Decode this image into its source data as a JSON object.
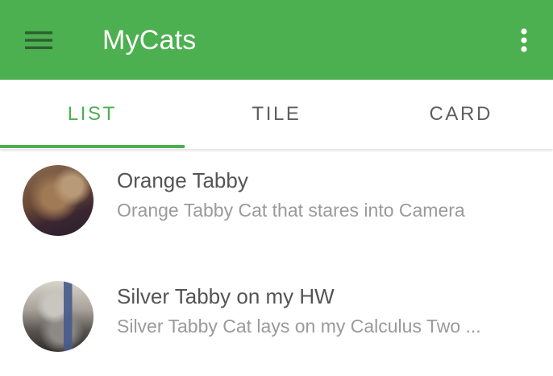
{
  "colors": {
    "primary": "#4caf50",
    "toolbar_text": "#ffffff",
    "tab_inactive": "#5f5f5f",
    "title_text": "#545454",
    "subtitle_text": "#9a9a9a"
  },
  "toolbar": {
    "title": "MyCats",
    "menu_icon": "hamburger-menu-icon",
    "overflow_icon": "more-vertical-icon"
  },
  "tabs": [
    {
      "label": "LIST",
      "active": true
    },
    {
      "label": "TILE",
      "active": false
    },
    {
      "label": "CARD",
      "active": false
    }
  ],
  "items": [
    {
      "title": "Orange Tabby",
      "subtitle": "Orange Tabby Cat that stares into Camera",
      "avatar": "orange-tabby-cat-photo"
    },
    {
      "title": "Silver Tabby on my HW",
      "subtitle": "Silver Tabby Cat lays on my Calculus Two ...",
      "avatar": "silver-tabby-cat-photo"
    }
  ]
}
